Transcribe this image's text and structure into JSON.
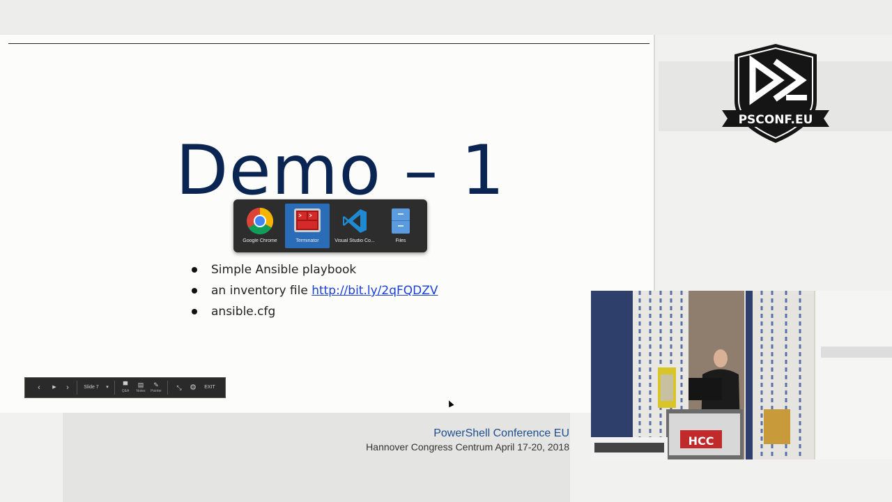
{
  "slide": {
    "title": "Demo – 1",
    "bullets": [
      {
        "text": "Simple Ansible playbook",
        "link": ""
      },
      {
        "text": "an inventory file ",
        "link": "http://bit.ly/2qFQDZV"
      },
      {
        "text": "ansible.cfg",
        "link": ""
      }
    ]
  },
  "app_switcher": {
    "apps": [
      {
        "label": "Google Chrome",
        "icon": "chrome-icon",
        "selected": false
      },
      {
        "label": "Terminator",
        "icon": "terminator-icon",
        "selected": true
      },
      {
        "label": "Visual Studio Co...",
        "icon": "vscode-icon",
        "selected": false
      },
      {
        "label": "Files",
        "icon": "files-icon",
        "selected": false
      }
    ]
  },
  "toolbar": {
    "prev_glyph": "‹",
    "play_glyph": "▶",
    "next_glyph": "›",
    "slide_label": "Slide 7",
    "slide_dropdown_glyph": "▾",
    "qa_label": "Q&A",
    "notes_label": "Notes",
    "pointer_label": "Pointer",
    "exit_label": "EXIT"
  },
  "logo": {
    "text": "PSCONF.EU"
  },
  "footer": {
    "conference": "PowerShell Conference EU",
    "venue": "Hannover Congress Centrum April 17-20, 2018"
  },
  "camera": {
    "sign_text": "HCC"
  },
  "colors": {
    "title": "#0b2552",
    "link": "#1a3fd6",
    "conference": "#1e4f8c",
    "switcher_selected": "#2b6cb8"
  }
}
